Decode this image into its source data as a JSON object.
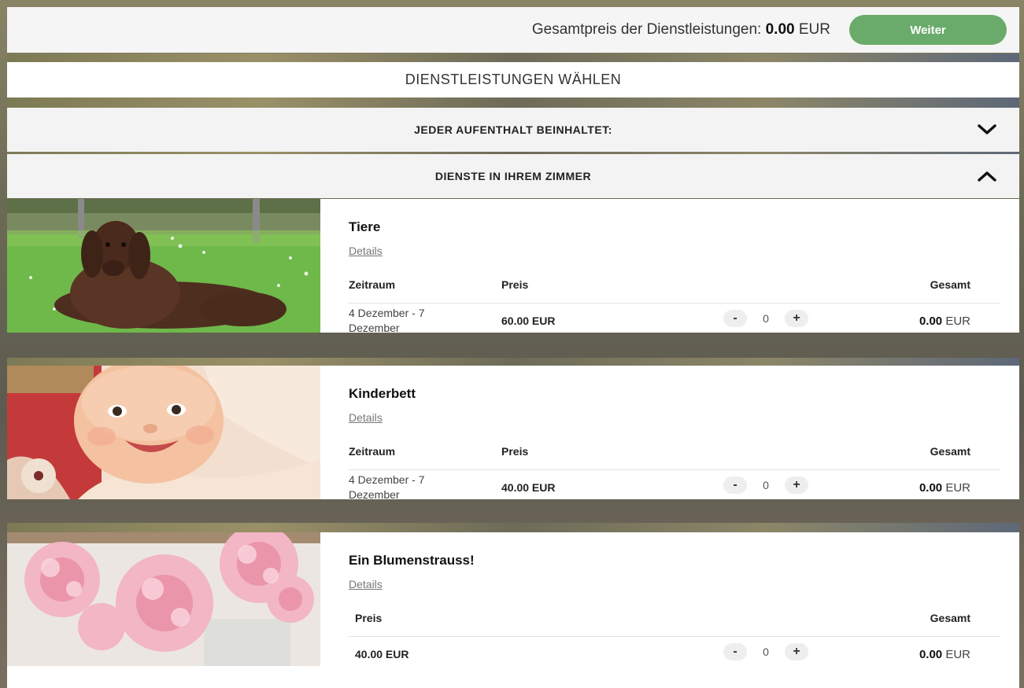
{
  "topbar": {
    "total_label": "Gesamtpreis der Dienstleistungen:",
    "total_value": "0.00",
    "total_currency": "EUR",
    "continue_label": "Weiter"
  },
  "section_title": "DIENSTLEISTUNGEN WÄHLEN",
  "accordions": [
    {
      "label": "JEDER AUFENTHALT BEINHALTET:",
      "state": "collapsed",
      "icon": "chevron-down-icon"
    },
    {
      "label": "DIENSTE IN IHREM ZIMMER",
      "state": "expanded",
      "icon": "chevron-up-icon"
    }
  ],
  "services": [
    {
      "name": "Tiere",
      "details": "Details",
      "col_period": "Zeitraum",
      "col_price": "Preis",
      "col_total": "Gesamt",
      "period": "4 Dezember - 7 Dezember",
      "price": "60.00 EUR",
      "minus": "-",
      "qty": "0",
      "plus": "+",
      "total_value": "0.00",
      "total_currency": "EUR"
    },
    {
      "name": "Kinderbett",
      "details": "Details",
      "col_period": "Zeitraum",
      "col_price": "Preis",
      "col_total": "Gesamt",
      "period": "4 Dezember - 7 Dezember",
      "price": "40.00 EUR",
      "minus": "-",
      "qty": "0",
      "plus": "+",
      "total_value": "0.00",
      "total_currency": "EUR"
    },
    {
      "name": "Ein Blumenstrauss!",
      "details": "Details",
      "col_price": "Preis",
      "col_total": "Gesamt",
      "price": "40.00 EUR",
      "minus": "-",
      "qty": "0",
      "plus": "+",
      "total_value": "0.00",
      "total_currency": "EUR"
    }
  ],
  "colors": {
    "accent_button": "#6aaa6a",
    "panel": "#f3f3f3",
    "card": "#ffffff"
  }
}
